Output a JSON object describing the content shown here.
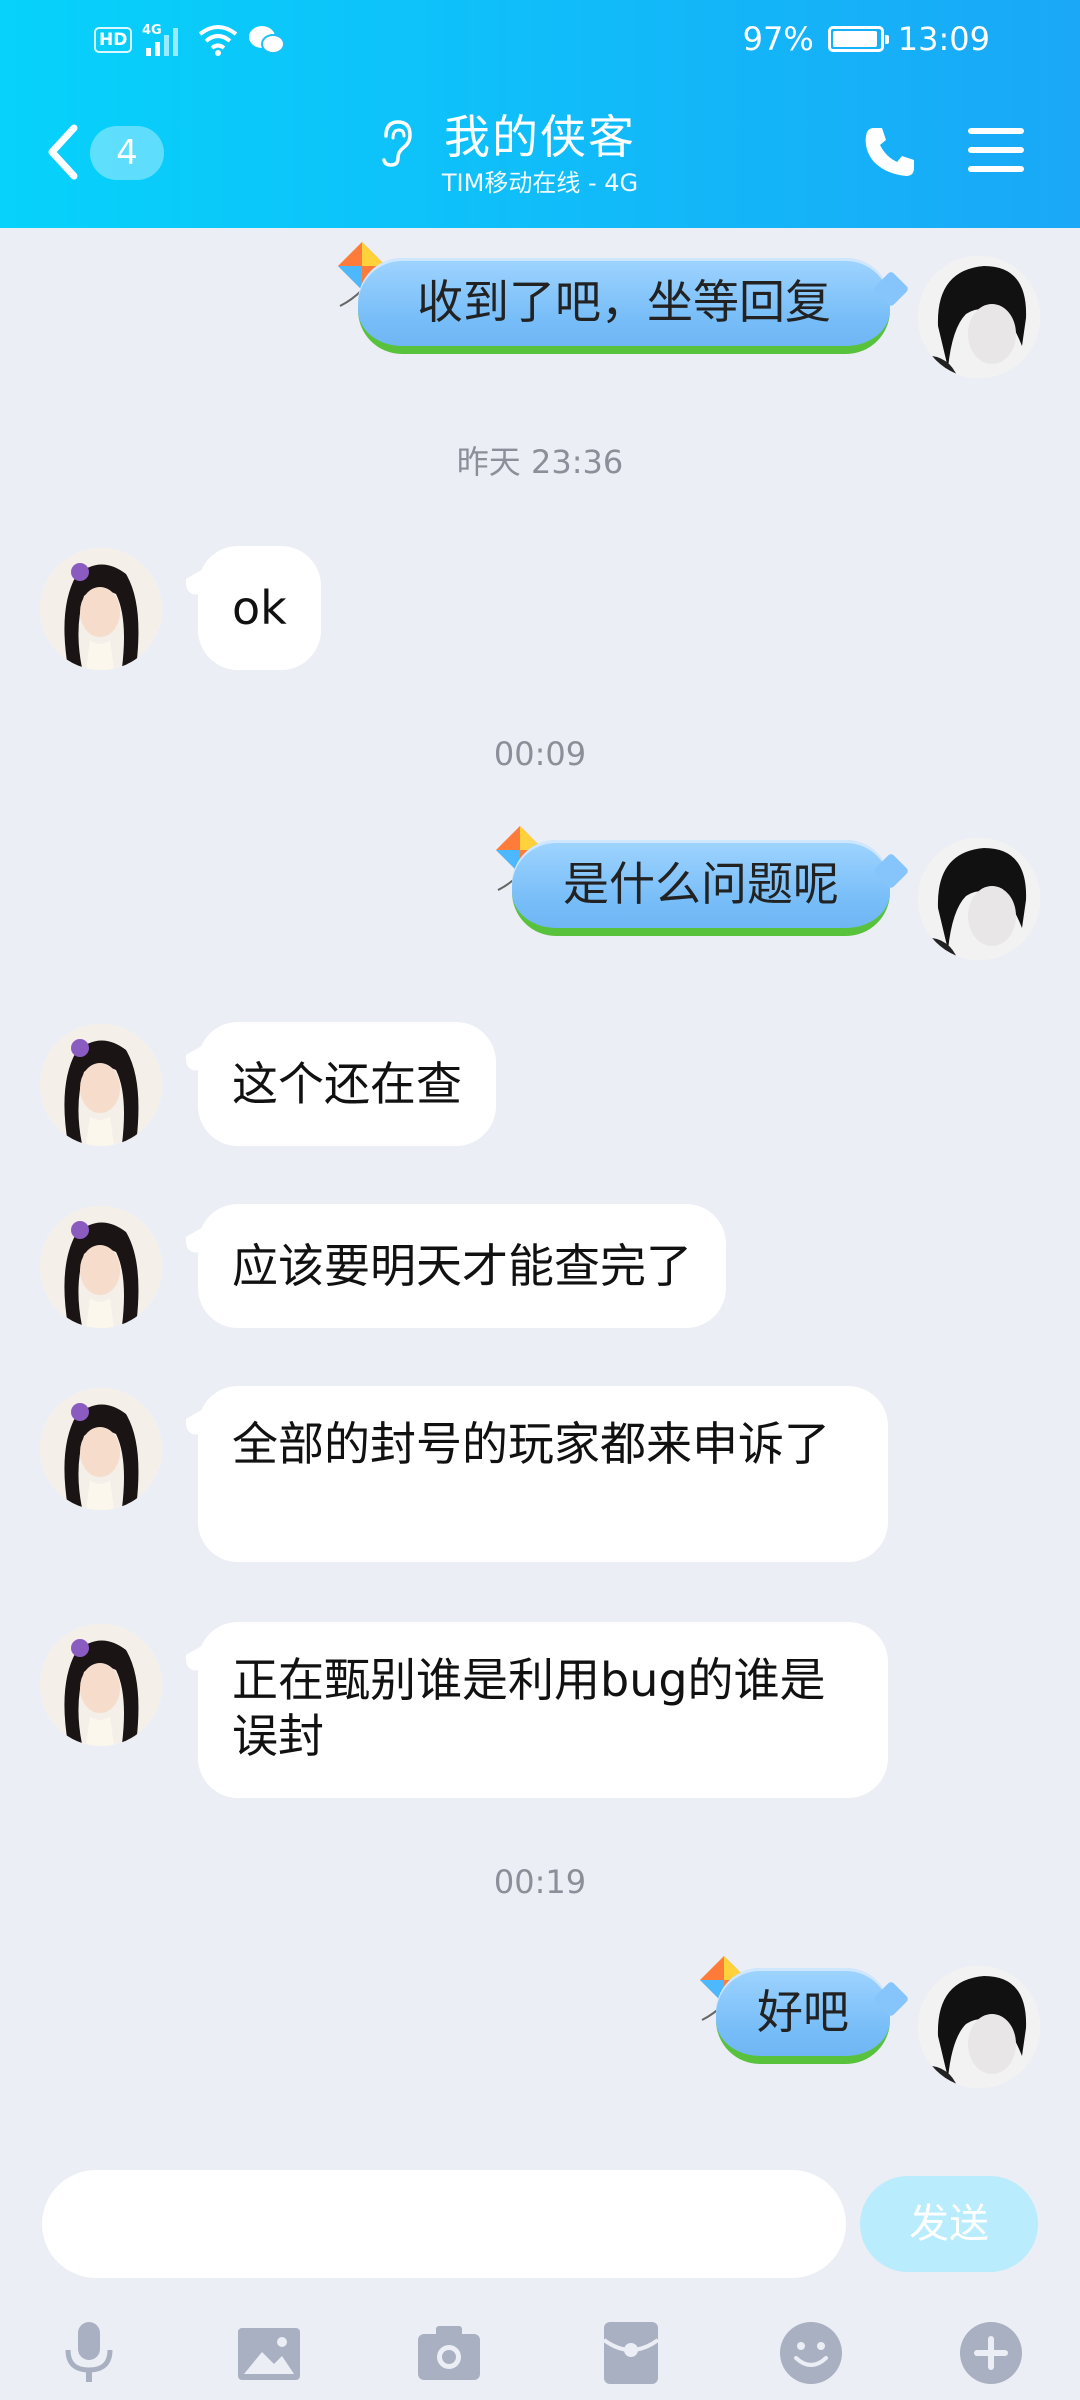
{
  "status_bar": {
    "hd_label": "HD",
    "network_label": "4G",
    "battery": "97%",
    "battery_level": 0.97,
    "time": "13:09"
  },
  "header": {
    "unread_count": "4",
    "title": "我的侠客",
    "subtitle": "TIM移动在线 - 4G",
    "icons": [
      "back-chevron-icon",
      "ear-icon",
      "phone-icon",
      "menu-icon"
    ],
    "gradient": [
      "#06d2fb",
      "#1aa8f7"
    ]
  },
  "messages": [
    {
      "side": "sent",
      "text": "收到了吧，坐等回复"
    },
    {
      "type": "time",
      "text": "昨天 23:36"
    },
    {
      "side": "received",
      "text": "ok"
    },
    {
      "type": "time",
      "text": "00:09"
    },
    {
      "side": "sent",
      "text": "是什么问题呢"
    },
    {
      "side": "received",
      "text": "这个还在查"
    },
    {
      "side": "received",
      "text": "应该要明天才能查完了"
    },
    {
      "side": "received",
      "text": "全部的封号的玩家都来申诉了"
    },
    {
      "side": "received",
      "text": "正在甄别谁是利用bug的谁是误封"
    },
    {
      "type": "time",
      "text": "00:19"
    },
    {
      "side": "sent",
      "text": "好吧"
    }
  ],
  "input": {
    "value": "",
    "placeholder": "",
    "send_label": "发送"
  },
  "toolbar": [
    "microphone-icon",
    "image-icon",
    "camera-icon",
    "red-packet-icon",
    "emoji-icon",
    "plus-icon"
  ],
  "colors": {
    "accent": "#1aa8f7",
    "background": "#eceef5",
    "sent_bubble": "#8ccafc",
    "send_button": "#b9ecfd"
  }
}
